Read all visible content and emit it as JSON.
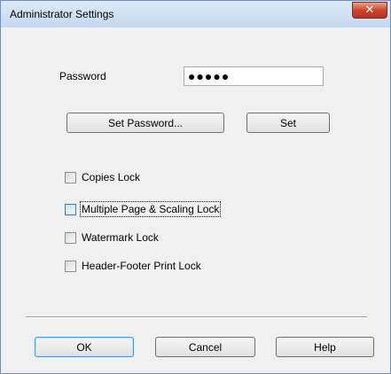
{
  "window": {
    "title": "Administrator Settings",
    "close_glyph": "✕"
  },
  "password": {
    "label": "Password",
    "value": "●●●●●"
  },
  "buttons": {
    "set_password": "Set Password...",
    "set": "Set",
    "ok": "OK",
    "cancel": "Cancel",
    "help": "Help"
  },
  "checkboxes": [
    {
      "label": "Copies Lock",
      "checked": false
    },
    {
      "label": "Multiple Page & Scaling Lock",
      "checked": false
    },
    {
      "label": "Watermark Lock",
      "checked": false
    },
    {
      "label": "Header-Footer Print Lock",
      "checked": false
    }
  ],
  "colors": {
    "title_bar": "#c6d9f0",
    "close_button": "#c9452b",
    "default_button_border": "#3399ff"
  }
}
